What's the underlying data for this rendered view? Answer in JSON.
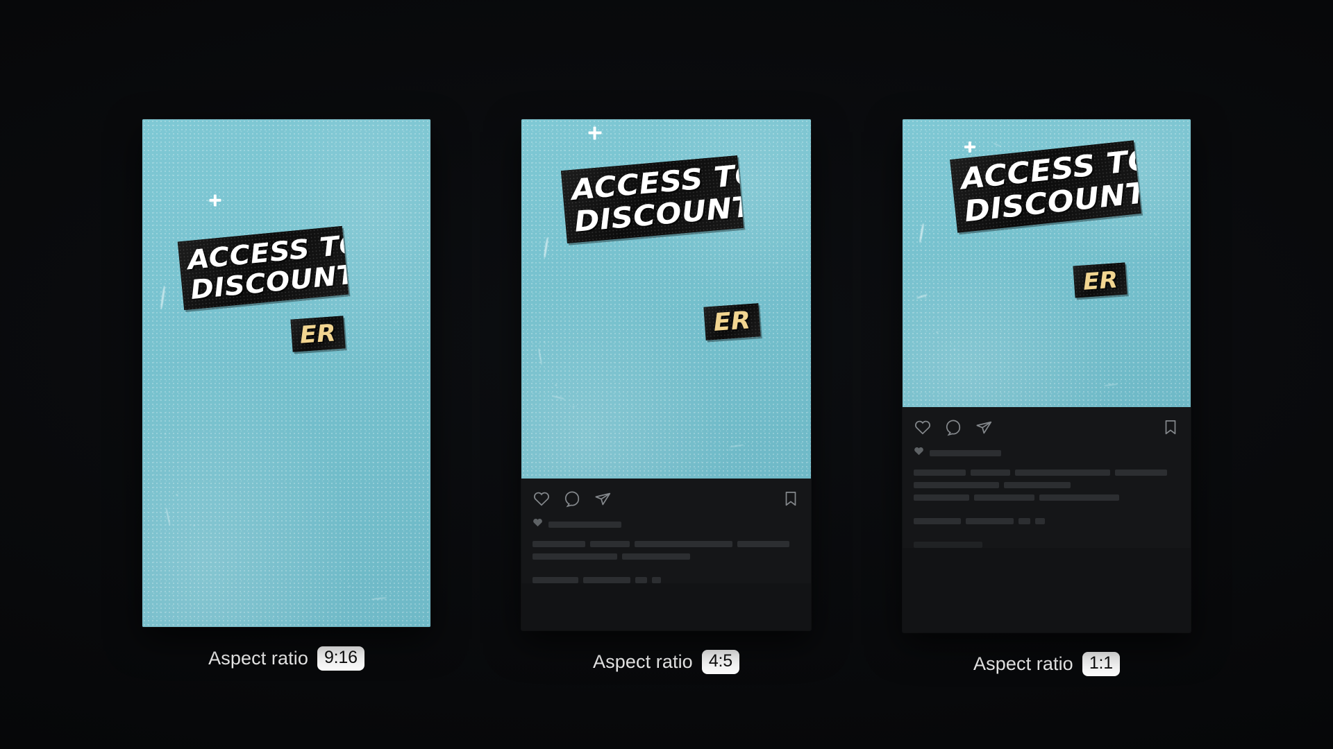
{
  "background_color": "#070809",
  "artwork": {
    "background_color": "#77c2cf",
    "sticker_background": "#141414",
    "headline_line1": "ACCESS TO",
    "headline_line2": "DISCOUNTS",
    "headline_color": "#ffffff",
    "badge_text": "ER",
    "badge_color": "#f2d591",
    "decoration_icon": "plus-sparkle-icon"
  },
  "social_footer": {
    "like_icon": "heart-icon",
    "comment_icon": "comment-bubble-icon",
    "share_icon": "paper-plane-icon",
    "save_icon": "bookmark-icon",
    "likes_icon": "heart-filled-icon",
    "icon_color": "#9aa0a6",
    "skeleton_color": "#2c2e31"
  },
  "previews": [
    {
      "name": "story-preview",
      "caption_label": "Aspect ratio",
      "ratio": "9:16",
      "has_social_footer": false
    },
    {
      "name": "portrait-preview",
      "caption_label": "Aspect ratio",
      "ratio": "4:5",
      "has_social_footer": true
    },
    {
      "name": "square-preview",
      "caption_label": "Aspect ratio",
      "ratio": "1:1",
      "has_social_footer": true
    }
  ]
}
